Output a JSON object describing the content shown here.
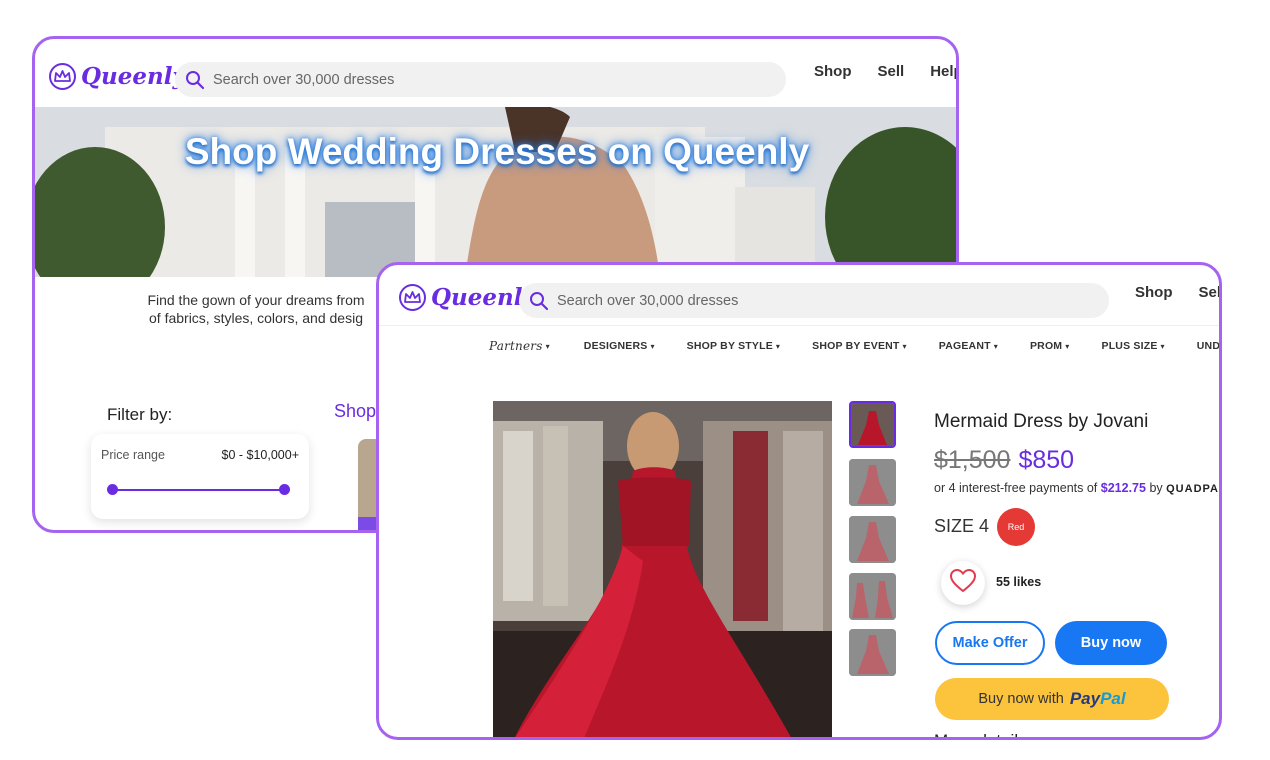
{
  "brand": {
    "name": "Queenly",
    "accent": "#6a2ce0",
    "frame": "#a663f0"
  },
  "back_window": {
    "search": {
      "placeholder": "Search over 30,000 dresses"
    },
    "nav": [
      "Shop",
      "Sell",
      "Help"
    ],
    "hero": {
      "title": "Shop Wedding Dresses on Queenly"
    },
    "description": {
      "line1": "Find the gown of your dreams from",
      "line2": "of fabrics, styles, colors, and desig"
    },
    "filter": {
      "label": "Filter by:",
      "price_label": "Price range",
      "price_value": "$0 - $10,000+"
    },
    "shop_link": "Shop"
  },
  "front_window": {
    "search": {
      "placeholder": "Search over 30,000 dresses"
    },
    "nav": [
      "Shop",
      "Sell"
    ],
    "categories": [
      "Partners",
      "DESIGNERS",
      "SHOP BY STYLE",
      "SHOP BY EVENT",
      "PAGEANT",
      "PROM",
      "PLUS SIZE",
      "UNDI"
    ],
    "product": {
      "title": "Mermaid Dress by Jovani",
      "price_old": "$1,500",
      "price_new": "$850",
      "installments_prefix": "or 4 interest-free payments of",
      "installment_amount": "$212.75",
      "installments_by": "by",
      "installments_provider": "QUADPA",
      "size": "SIZE 4",
      "color": "Red",
      "likes": "55 likes",
      "make_offer": "Make Offer",
      "buy_now": "Buy now",
      "paypal_prefix": "Buy now with",
      "paypal_pay": "Pay",
      "paypal_pal": "Pal",
      "more_details": "More details"
    },
    "thumbnails": 5
  },
  "colors": {
    "buy_blue": "#1877f2",
    "paypal_yellow": "#fcc33c",
    "color_red": "#e53935"
  }
}
